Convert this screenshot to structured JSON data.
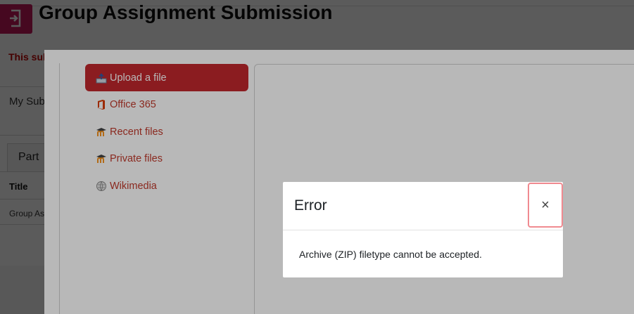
{
  "page": {
    "title": "Group Assignment Submission",
    "warning_fragment": "This sub",
    "my_submission_fragment": "My Sub",
    "tab_fragment": "Part",
    "table_header_fragment": "Title",
    "row_fragment": "Group As"
  },
  "file_picker": {
    "repositories": [
      {
        "label": "Upload a file",
        "icon": "upload-icon",
        "active": true
      },
      {
        "label": "Office 365",
        "icon": "office365-icon"
      },
      {
        "label": "Recent files",
        "icon": "moodle-icon"
      },
      {
        "label": "Private files",
        "icon": "moodle-icon"
      },
      {
        "label": "Wikimedia",
        "icon": "wikimedia-icon"
      }
    ]
  },
  "dialog": {
    "title": "Error",
    "close_symbol": "×",
    "message": "Archive (ZIP) filetype cannot be accepted."
  },
  "colors": {
    "accent": "#c1272d",
    "link": "#c0392b",
    "brand": "#c2185b",
    "warning": "#c00000"
  }
}
